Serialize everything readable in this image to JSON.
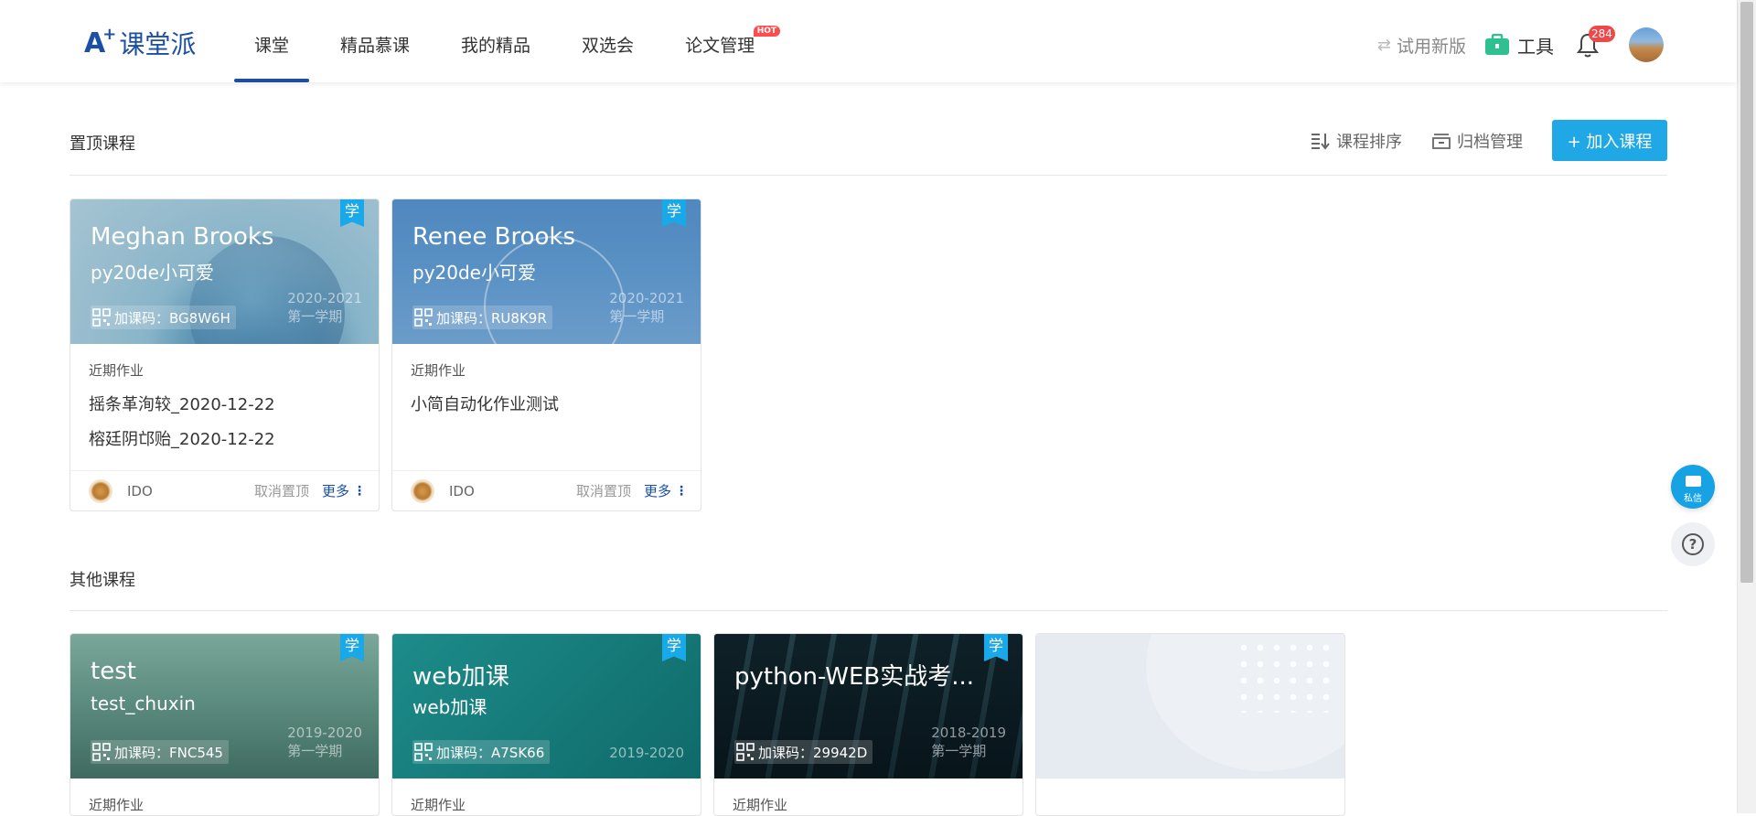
{
  "header": {
    "logo_a": "A",
    "logo_plus": "+",
    "logo_text": "课堂派",
    "nav": [
      {
        "label": "课堂",
        "active": true
      },
      {
        "label": "精品慕课"
      },
      {
        "label": "我的精品"
      },
      {
        "label": "双选会"
      },
      {
        "label": "论文管理",
        "tag": "HOT"
      }
    ],
    "try_new": "试用新版",
    "tools_label": "工具",
    "notification_count": "284"
  },
  "pinned": {
    "title": "置顶课程",
    "sort_label": "课程排序",
    "archive_label": "归档管理",
    "join_label": "+ 加入课程",
    "cards": [
      {
        "title": "Meghan Brooks",
        "subtitle": "py20de小可爱",
        "code": "加课码：BG8W6H",
        "year": "2020-2021",
        "semester": "第一学期",
        "ribbon": "学",
        "recent_label": "近期作业",
        "homework": [
          "摇条革洵较_2020-12-22",
          "榕廷阴邙贻_2020-12-22"
        ],
        "owner": "IDO",
        "unpin": "取消置顶",
        "more": "更多"
      },
      {
        "title": "Renee Brooks",
        "subtitle": "py20de小可爱",
        "code": "加课码：RU8K9R",
        "year": "2020-2021",
        "semester": "第一学期",
        "ribbon": "学",
        "recent_label": "近期作业",
        "homework": [
          "小简自动化作业测试"
        ],
        "owner": "IDO",
        "unpin": "取消置顶",
        "more": "更多"
      }
    ]
  },
  "others": {
    "title": "其他课程",
    "cards": [
      {
        "title": "test",
        "subtitle": "test_chuxin",
        "code": "加课码：FNC545",
        "year": "2019-2020",
        "semester": "第一学期",
        "ribbon": "学",
        "recent_label": "近期作业"
      },
      {
        "title": "web加课",
        "subtitle": "web加课",
        "code": "加课码：A7SK66",
        "year": "2019-2020",
        "semester": "",
        "ribbon": "学",
        "recent_label": "近期作业"
      },
      {
        "title": "python-WEB实战考...",
        "subtitle": "",
        "code": "加课码：29942D",
        "year": "2018-2019",
        "semester": "第一学期",
        "ribbon": "学",
        "recent_label": "近期作业"
      }
    ]
  },
  "float": {
    "message_label": "私信",
    "help_symbol": "?"
  },
  "colors": {
    "brand": "#1b4ea5",
    "accent": "#20a8e6",
    "badge": "#f04848"
  }
}
